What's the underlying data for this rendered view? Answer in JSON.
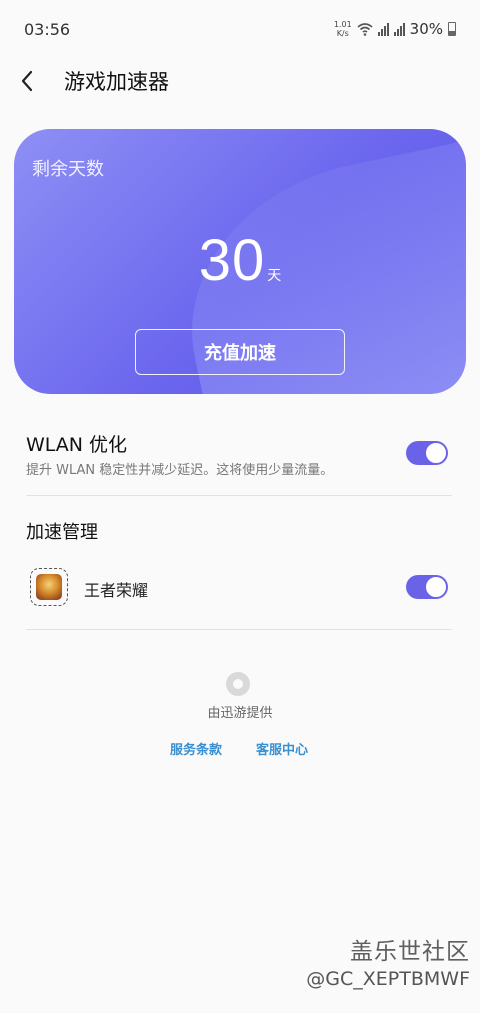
{
  "status_bar": {
    "time": "03:56",
    "net_speed_value": "1.01",
    "net_speed_unit": "K/s",
    "battery": "30%"
  },
  "header": {
    "title": "游戏加速器"
  },
  "card": {
    "label": "剩余天数",
    "days": "30",
    "days_unit": "天",
    "button_label": "充值加速"
  },
  "wlan": {
    "title": "WLAN 优化",
    "description": "提升 WLAN 稳定性并减少延迟。这将使用少量流量。",
    "enabled": true
  },
  "manage": {
    "title": "加速管理",
    "games": [
      {
        "name": "王者荣耀",
        "enabled": true
      }
    ]
  },
  "footer": {
    "provider": "由迅游提供",
    "links": [
      "服务条款",
      "客服中心"
    ]
  },
  "watermark": {
    "line1": "盖乐世社区",
    "line2": "@GC_XEPTBMWF"
  },
  "colors": {
    "accent": "#6a63e8",
    "link": "#3a8fd0",
    "card_gradient_start": "#8e8ff5",
    "card_gradient_end": "#5c55ea"
  }
}
